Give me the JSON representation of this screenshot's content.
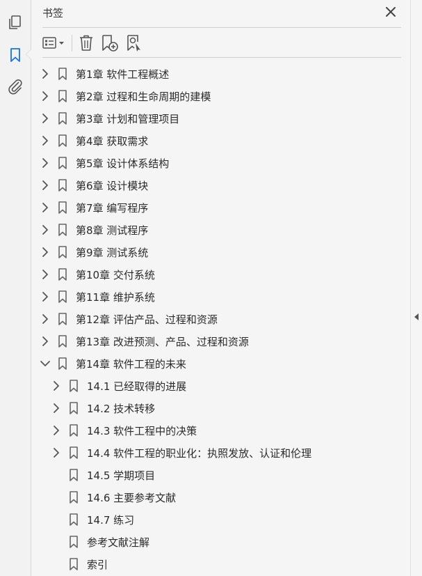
{
  "panel": {
    "title": "书签"
  },
  "bookmarks": [
    {
      "label": "第1章 软件工程概述",
      "level": 0,
      "expand": "collapsed"
    },
    {
      "label": "第2章 过程和生命周期的建模",
      "level": 0,
      "expand": "collapsed"
    },
    {
      "label": "第3章 计划和管理项目",
      "level": 0,
      "expand": "collapsed"
    },
    {
      "label": "第4章 获取需求",
      "level": 0,
      "expand": "collapsed"
    },
    {
      "label": "第5章 设计体系结构",
      "level": 0,
      "expand": "collapsed"
    },
    {
      "label": "第6章 设计模块",
      "level": 0,
      "expand": "collapsed"
    },
    {
      "label": "第7章 编写程序",
      "level": 0,
      "expand": "collapsed"
    },
    {
      "label": "第8章 测试程序",
      "level": 0,
      "expand": "collapsed"
    },
    {
      "label": "第9章 测试系统",
      "level": 0,
      "expand": "collapsed"
    },
    {
      "label": "第10章 交付系统",
      "level": 0,
      "expand": "collapsed"
    },
    {
      "label": "第11章 维护系统",
      "level": 0,
      "expand": "collapsed"
    },
    {
      "label": "第12章 评估产品、过程和资源",
      "level": 0,
      "expand": "collapsed"
    },
    {
      "label": "第13章 改进预测、产品、过程和资源",
      "level": 0,
      "expand": "collapsed"
    },
    {
      "label": "第14章 软件工程的未来",
      "level": 0,
      "expand": "expanded"
    },
    {
      "label": "14.1 已经取得的进展",
      "level": 1,
      "expand": "collapsed"
    },
    {
      "label": "14.2 技术转移",
      "level": 1,
      "expand": "collapsed"
    },
    {
      "label": "14.3 软件工程中的决策",
      "level": 1,
      "expand": "collapsed"
    },
    {
      "label": "14.4 软件工程的职业化：执照发放、认证和伦理",
      "level": 1,
      "expand": "collapsed"
    },
    {
      "label": "14.5 学期项目",
      "level": 1,
      "expand": "none"
    },
    {
      "label": "14.6 主要参考文献",
      "level": 1,
      "expand": "none"
    },
    {
      "label": "14.7 练习",
      "level": 1,
      "expand": "none"
    },
    {
      "label": "参考文献注解",
      "level": 1,
      "expand": "none"
    },
    {
      "label": "索引",
      "level": 1,
      "expand": "none"
    }
  ],
  "icons": {
    "left_pages": "pages-icon",
    "left_bookmarks": "bookmark-icon",
    "left_attachments": "paperclip-icon",
    "options": "options-menu-icon",
    "delete": "trash-icon",
    "new": "new-bookmark-icon",
    "find": "find-bookmark-icon",
    "close": "close-icon"
  },
  "colors": {
    "accent": "#1473e6",
    "icon": "#555555"
  }
}
